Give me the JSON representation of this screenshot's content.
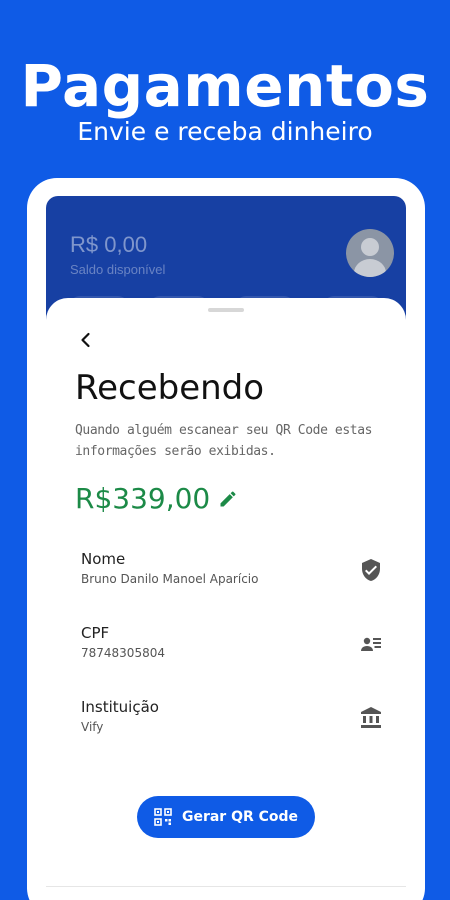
{
  "promo": {
    "title": "Pagamentos",
    "subtitle": "Envie e receba dinheiro"
  },
  "app_header": {
    "balance": "R$ 0,00",
    "balance_label": "Saldo disponível"
  },
  "screen": {
    "title": "Recebendo",
    "description": "Quando alguém escanear seu QR Code estas informações serão exibidas.",
    "amount": "R$339,00"
  },
  "info_rows": [
    {
      "label": "Nome",
      "value": "Bruno Danilo Manoel Aparício",
      "icon": "shield-check-icon"
    },
    {
      "label": "CPF",
      "value": "78748305804",
      "icon": "id-card-icon"
    },
    {
      "label": "Instituição",
      "value": "Vify",
      "icon": "bank-icon"
    }
  ],
  "actions": {
    "generate_qr_label": "Gerar QR Code"
  },
  "colors": {
    "brand_blue": "#0f5be6",
    "header_blue": "#1740a3",
    "amount_green": "#1c8a47"
  }
}
